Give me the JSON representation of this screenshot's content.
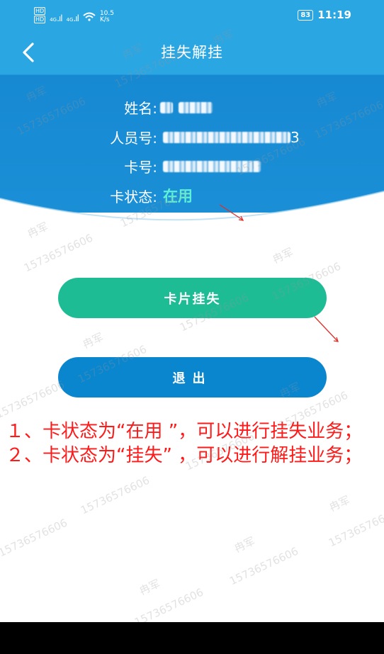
{
  "status_bar": {
    "left_badges": [
      "HD",
      "HD"
    ],
    "network": "4G",
    "network2": "4G",
    "speed_value": "10.5",
    "speed_unit": "K/s",
    "battery": "83",
    "time": "11:19"
  },
  "nav": {
    "title": "挂失解挂",
    "back_icon": "chevron-left-icon"
  },
  "card_info": {
    "name_label": "姓名:",
    "id_label": "人员号:",
    "id_suffix": "3",
    "card_label": "卡号:",
    "status_label": "卡状态:",
    "status_value": "在用"
  },
  "buttons": {
    "report_lost": "卡片挂失",
    "exit": "退出"
  },
  "annotation": {
    "line1": "１、卡状态为“在用 ”，可以进行挂失业务；",
    "line2": "２、卡状态为“挂失” ，可以进行解挂业务；"
  },
  "watermark": {
    "name": "冉军",
    "phone": "15736576606"
  },
  "colors": {
    "header": "#2aa6e3",
    "report_button": "#1ebc95",
    "exit_button": "#0a86cf",
    "status": "#5ef0d6",
    "annotation": "#ff1a1a"
  }
}
